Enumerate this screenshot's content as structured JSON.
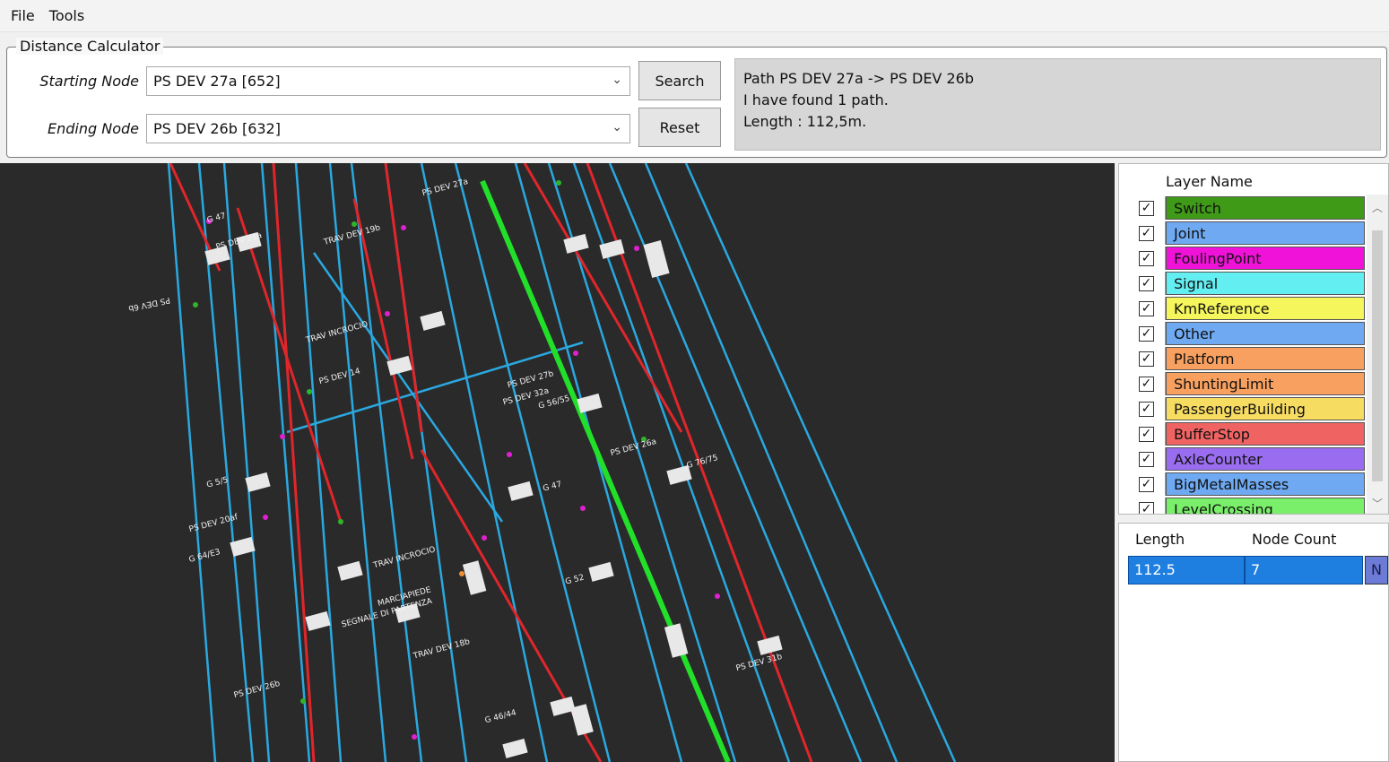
{
  "menu": {
    "file": "File",
    "tools": "Tools"
  },
  "calculator": {
    "title": "Distance Calculator",
    "starting_label": "Starting Node",
    "starting_value": "PS DEV 27a [652]",
    "ending_label": "Ending Node",
    "ending_value": "PS DEV 26b [632]",
    "search_label": "Search",
    "reset_label": "Reset",
    "result_lines": [
      "Path PS DEV 27a -> PS DEV 26b",
      "I have found 1 path.",
      "Length : 112,5m."
    ]
  },
  "layers": {
    "header": "Layer Name",
    "items": [
      {
        "name": "Switch",
        "color": "#3f9a17",
        "checked": true
      },
      {
        "name": "Joint",
        "color": "#6ea9f2",
        "checked": true
      },
      {
        "name": "FoulingPoint",
        "color": "#f012d8",
        "checked": true
      },
      {
        "name": "Signal",
        "color": "#63eef2",
        "checked": true
      },
      {
        "name": "KmReference",
        "color": "#f5f55c",
        "checked": true
      },
      {
        "name": "Other",
        "color": "#6ea9f2",
        "checked": true
      },
      {
        "name": "Platform",
        "color": "#f7a060",
        "checked": true
      },
      {
        "name": "ShuntingLimit",
        "color": "#f7a060",
        "checked": true
      },
      {
        "name": "PassengerBuilding",
        "color": "#f7dc62",
        "checked": true
      },
      {
        "name": "BufferStop",
        "color": "#f06363",
        "checked": true
      },
      {
        "name": "AxleCounter",
        "color": "#9a6cf0",
        "checked": true
      },
      {
        "name": "BigMetalMasses",
        "color": "#6ea9f2",
        "checked": true
      },
      {
        "name": "LevelCrossing",
        "color": "#7af06a",
        "checked": true
      }
    ]
  },
  "paths": {
    "length_header": "Length",
    "count_header": "Node Count",
    "row": {
      "length": "112.5",
      "count": "7",
      "flag": "N"
    }
  },
  "map": {
    "labels": [
      "PS DEV 26b",
      "PS DEV 27b",
      "PS DEV 27a",
      "PS DEV 26a",
      "TRAV DEV 19b",
      "TRAV INCROCIO",
      "G 64/E3",
      "PS DEV 20af",
      "G 52",
      "SEGNALE DI PARTENZA",
      "MARCIAPIEDE",
      "PS DEV 32a",
      "PS DEV 14",
      "G 76/75",
      "G 46/44",
      "PS DEV 31b",
      "G 47",
      "G 56/55",
      "PS DEV 6b",
      "TRAV DEV 18b",
      "PS DEV 21a",
      "G 5/5"
    ]
  }
}
